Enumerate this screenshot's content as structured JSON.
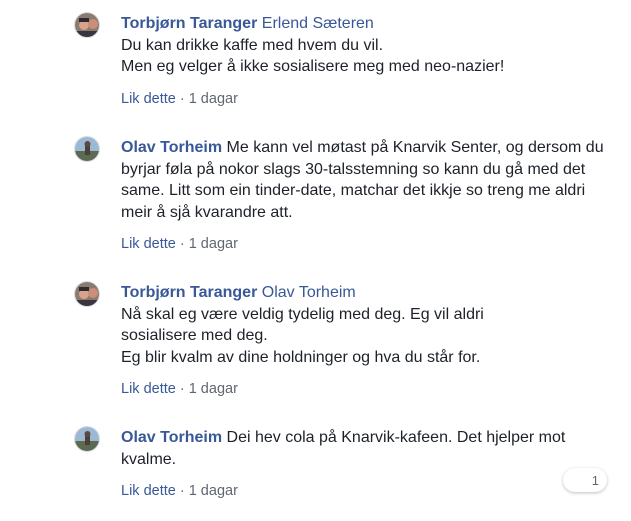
{
  "comments": [
    {
      "author": "Torbjørn Taranger",
      "tag": "Erlend Sæteren",
      "lines": [
        "Du kan drikke kaffe med hvem du vil.",
        "Men eg velger å ikke sosialisere meg med neo-nazier!"
      ],
      "like_label": "Lik dette",
      "separator": " · ",
      "time": "1 dagar",
      "avatar": "avatar-torbjorn"
    },
    {
      "author": "Olav Torheim",
      "text": "Me kann vel møtast på Knarvik Senter, og dersom du byrjar føla på nokor slags 30-talsstemning so kann du gå med det same. Litt som ein tinder-date, matchar det ikkje so treng me aldri meir å sjå kvarandre att.",
      "like_label": "Lik dette",
      "separator": " · ",
      "time": "1 dagar",
      "avatar": "avatar-olav"
    },
    {
      "author": "Torbjørn Taranger",
      "tag": "Olav Torheim",
      "lines": [
        "Nå skal eg være veldig tydelig med deg. Eg vil aldri",
        "sosialisere med deg.",
        "Eg blir kvalm av dine holdninger og hva du står for."
      ],
      "like_label": "Lik dette",
      "separator": " · ",
      "time": "1 dagar",
      "avatar": "avatar-torbjorn"
    },
    {
      "author": "Olav Torheim",
      "text": "Dei hev cola på Knarvik-kafeen. Det hjelper mot kvalme.",
      "like_label": "Lik dette",
      "separator": " · ",
      "time": "1 dagar",
      "avatar": "avatar-olav"
    }
  ],
  "reaction_count": "1",
  "colors": {
    "link": "#385898",
    "text": "#1d2129",
    "meta": "#606770"
  }
}
